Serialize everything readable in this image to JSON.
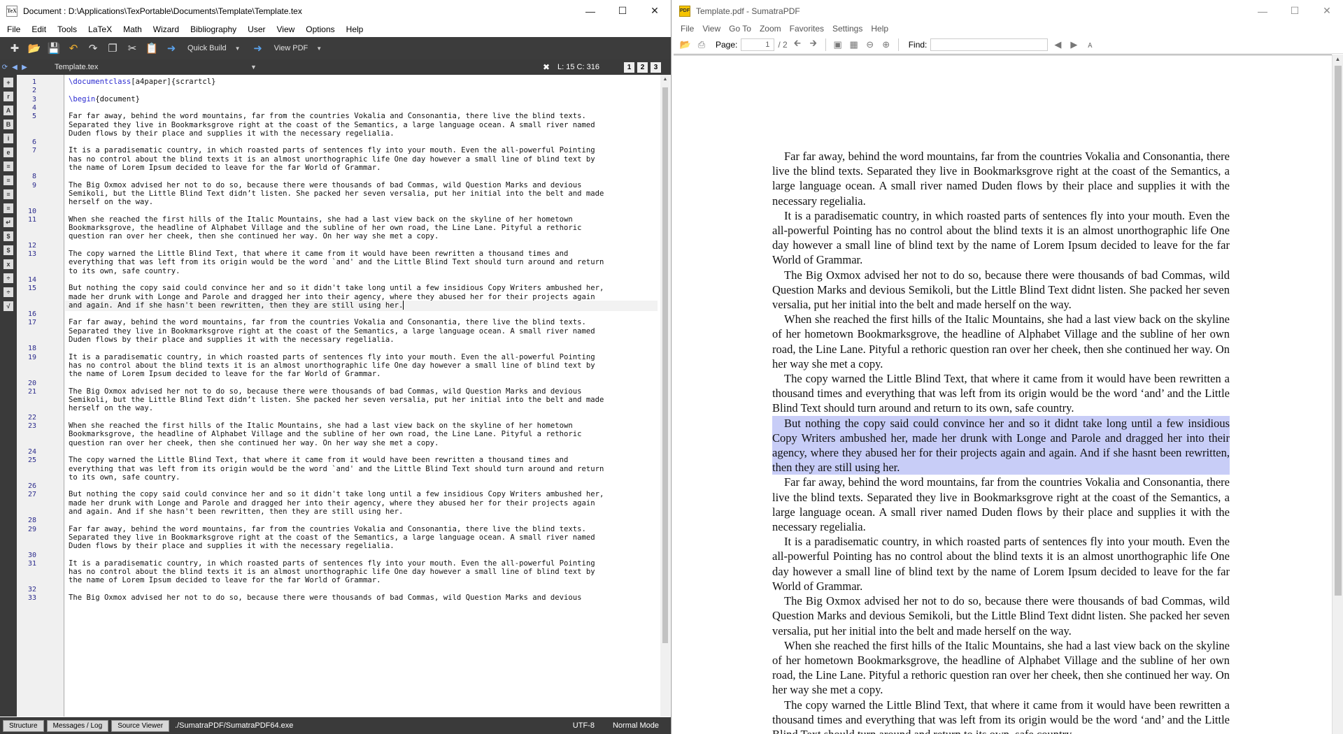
{
  "left": {
    "title": "Document : D:\\Applications\\TexPortable\\Documents\\Template\\Template.tex",
    "menu": [
      "File",
      "Edit",
      "Tools",
      "LaTeX",
      "Math",
      "Wizard",
      "Bibliography",
      "User",
      "View",
      "Options",
      "Help"
    ],
    "toolbar": {
      "quick_build": "Quick Build",
      "view_pdf": "View PDF"
    },
    "tab": {
      "name": "Template.tex",
      "position": "L: 15 C: 316",
      "views": [
        "1",
        "2",
        "3"
      ]
    },
    "statusbar": {
      "tabs": [
        "Structure",
        "Messages / Log",
        "Source Viewer"
      ],
      "path": "./SumatraPDF/SumatraPDF64.exe",
      "encoding": "UTF-8",
      "mode": "Normal Mode"
    },
    "line_numbers": [
      {
        "n": "1",
        "row": 0
      },
      {
        "n": "2",
        "row": 1
      },
      {
        "n": "3",
        "row": 2
      },
      {
        "n": "4",
        "row": 3
      },
      {
        "n": "5",
        "row": 4
      },
      {
        "n": "6",
        "row": 7
      },
      {
        "n": "7",
        "row": 8
      },
      {
        "n": "8",
        "row": 11
      },
      {
        "n": "9",
        "row": 12
      },
      {
        "n": "10",
        "row": 15
      },
      {
        "n": "11",
        "row": 16
      },
      {
        "n": "12",
        "row": 19
      },
      {
        "n": "13",
        "row": 20
      },
      {
        "n": "14",
        "row": 23
      },
      {
        "n": "15",
        "row": 24
      },
      {
        "n": "16",
        "row": 27
      },
      {
        "n": "17",
        "row": 28
      },
      {
        "n": "18",
        "row": 31
      },
      {
        "n": "19",
        "row": 32
      },
      {
        "n": "20",
        "row": 35
      },
      {
        "n": "21",
        "row": 36
      },
      {
        "n": "22",
        "row": 39
      },
      {
        "n": "23",
        "row": 40
      },
      {
        "n": "24",
        "row": 43
      },
      {
        "n": "25",
        "row": 44
      },
      {
        "n": "26",
        "row": 47
      },
      {
        "n": "27",
        "row": 48
      },
      {
        "n": "28",
        "row": 51
      },
      {
        "n": "29",
        "row": 52
      },
      {
        "n": "30",
        "row": 55
      },
      {
        "n": "31",
        "row": 56
      },
      {
        "n": "32",
        "row": 59
      },
      {
        "n": "33",
        "row": 60
      }
    ],
    "code_lines": [
      "\\documentclass[a4paper]{scrartcl}",
      "",
      "\\begin{document}",
      "",
      "Far far away, behind the word mountains, far from the countries Vokalia and Consonantia, there live the blind texts.",
      "Separated they live in Bookmarksgrove right at the coast of the Semantics, a large language ocean. A small river named",
      "Duden flows by their place and supplies it with the necessary regelialia.",
      "",
      "It is a paradisematic country, in which roasted parts of sentences fly into your mouth. Even the all-powerful Pointing",
      "has no control about the blind texts it is an almost unorthographic life One day however a small line of blind text by",
      "the name of Lorem Ipsum decided to leave for the far World of Grammar.",
      "",
      "The Big Oxmox advised her not to do so, because there were thousands of bad Commas, wild Question Marks and devious",
      "Semikoli, but the Little Blind Text didn’t listen. She packed her seven versalia, put her initial into the belt and made",
      "herself on the way.",
      "",
      "When she reached the first hills of the Italic Mountains, she had a last view back on the skyline of her hometown",
      "Bookmarksgrove, the headline of Alphabet Village and the subline of her own road, the Line Lane. Pityful a rethoric",
      "question ran over her cheek, then she continued her way. On her way she met a copy.",
      "",
      "The copy warned the Little Blind Text, that where it came from it would have been rewritten a thousand times and",
      "everything that was left from its origin would be the word `and' and the Little Blind Text should turn around and return",
      "to its own, safe country.",
      "",
      "But nothing the copy said could convince her and so it didn't take long until a few insidious Copy Writers ambushed her,",
      "made her drunk with Longe and Parole and dragged her into their agency, where they abused her for their projects again",
      "and again. And if she hasn't been rewritten, then they are still using her.",
      "",
      "Far far away, behind the word mountains, far from the countries Vokalia and Consonantia, there live the blind texts.",
      "Separated they live in Bookmarksgrove right at the coast of the Semantics, a large language ocean. A small river named",
      "Duden flows by their place and supplies it with the necessary regelialia.",
      "",
      "It is a paradisematic country, in which roasted parts of sentences fly into your mouth. Even the all-powerful Pointing",
      "has no control about the blind texts it is an almost unorthographic life One day however a small line of blind text by",
      "the name of Lorem Ipsum decided to leave for the far World of Grammar.",
      "",
      "The Big Oxmox advised her not to do so, because there were thousands of bad Commas, wild Question Marks and devious",
      "Semikoli, but the Little Blind Text didn’t listen. She packed her seven versalia, put her initial into the belt and made",
      "herself on the way.",
      "",
      "When she reached the first hills of the Italic Mountains, she had a last view back on the skyline of her hometown",
      "Bookmarksgrove, the headline of Alphabet Village and the subline of her own road, the Line Lane. Pityful a rethoric",
      "question ran over her cheek, then she continued her way. On her way she met a copy.",
      "",
      "The copy warned the Little Blind Text, that where it came from it would have been rewritten a thousand times and",
      "everything that was left from its origin would be the word `and' and the Little Blind Text should turn around and return",
      "to its own, safe country.",
      "",
      "But nothing the copy said could convince her and so it didn't take long until a few insidious Copy Writers ambushed her,",
      "made her drunk with Longe and Parole and dragged her into their agency, where they abused her for their projects again",
      "and again. And if she hasn't been rewritten, then they are still using her.",
      "",
      "Far far away, behind the word mountains, far from the countries Vokalia and Consonantia, there live the blind texts.",
      "Separated they live in Bookmarksgrove right at the coast of the Semantics, a large language ocean. A small river named",
      "Duden flows by their place and supplies it with the necessary regelialia.",
      "",
      "It is a paradisematic country, in which roasted parts of sentences fly into your mouth. Even the all-powerful Pointing",
      "has no control about the blind texts it is an almost unorthographic life One day however a small line of blind text by",
      "the name of Lorem Ipsum decided to leave for the far World of Grammar.",
      "",
      "The Big Oxmox advised her not to do so, because there were thousands of bad Commas, wild Question Marks and devious"
    ]
  },
  "right": {
    "title": "Template.pdf - SumatraPDF",
    "menu": [
      "File",
      "View",
      "Go To",
      "Zoom",
      "Favorites",
      "Settings",
      "Help"
    ],
    "toolbar": {
      "page_label": "Page:",
      "page_value": "1",
      "page_total": "/ 2",
      "find_label": "Find:"
    },
    "paragraphs": [
      "Far far away, behind the word mountains, far from the countries Vokalia and Consonantia, there live the blind texts. Separated they live in Bookmarksgrove right at the coast of the Semantics, a large language ocean. A small river named Duden flows by their place and supplies it with the necessary regelialia.",
      "It is a paradisematic country, in which roasted parts of sentences fly into your mouth. Even the all-powerful Pointing has no control about the blind texts it is an almost unorthographic life One day however a small line of blind text by the name of Lorem Ipsum decided to leave for the far World of Grammar.",
      "The Big Oxmox advised her not to do so, because there were thousands of bad Commas, wild Question Marks and devious Semikoli, but the Little Blind Text didnt listen. She packed her seven versalia, put her initial into the belt and made herself on the way.",
      "When she reached the first hills of the Italic Mountains, she had a last view back on the skyline of her hometown Bookmarksgrove, the headline of Alphabet Village and the subline of her own road, the Line Lane. Pityful a rethoric question ran over her cheek, then she continued her way. On her way she met a copy.",
      "The copy warned the Little Blind Text, that where it came from it would have been rewritten a thousand times and everything that was left from its origin would be the word ‘and’ and the Little Blind Text should turn around and return to its own, safe country.",
      "But nothing the copy said could convince her and so it didnt take long until a few insidious Copy Writers ambushed her, made her drunk with Longe and Parole and dragged her into their agency, where they abused her for their projects again and again. And if she hasnt been rewritten, then they are still using her.",
      "Far far away, behind the word mountains, far from the countries Vokalia and Consonantia, there live the blind texts. Separated they live in Bookmarksgrove right at the coast of the Semantics, a large language ocean. A small river named Duden flows by their place and supplies it with the necessary regelialia.",
      "It is a paradisematic country, in which roasted parts of sentences fly into your mouth. Even the all-powerful Pointing has no control about the blind texts it is an almost unorthographic life One day however a small line of blind text by the name of Lorem Ipsum decided to leave for the far World of Grammar.",
      "The Big Oxmox advised her not to do so, because there were thousands of bad Commas, wild Question Marks and devious Semikoli, but the Little Blind Text didnt listen. She packed her seven versalia, put her initial into the belt and made herself on the way.",
      "When she reached the first hills of the Italic Mountains, she had a last view back on the skyline of her hometown Bookmarksgrove, the headline of Alphabet Village and the subline of her own road, the Line Lane. Pityful a rethoric question ran over her cheek, then she continued her way. On her way she met a copy.",
      "The copy warned the Little Blind Text, that where it came from it would have been rewritten a thousand times and everything that was left from its origin would be the word ‘and’ and the Little Blind Text should turn around and return to its own, safe country."
    ],
    "selected_paragraph": 5
  },
  "colors": {
    "dark_ui": "#3a3a3a",
    "selection": "#c8cdf7",
    "line_number": "#2b2b8c",
    "keyword": "#2b2bd0"
  }
}
